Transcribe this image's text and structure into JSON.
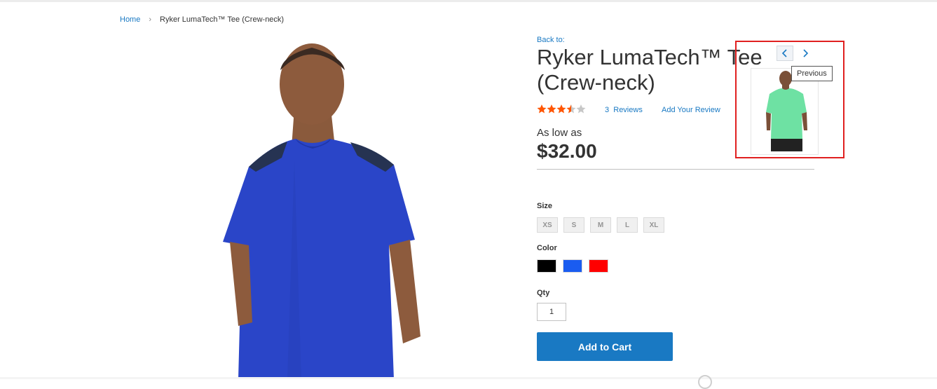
{
  "breadcrumbs": {
    "home": "Home",
    "separator": "›",
    "current": "Ryker LumaTech™ Tee (Crew-neck)"
  },
  "product": {
    "back_to": "Back to:",
    "title": "Ryker LumaTech™ Tee (Crew-neck)",
    "rating": {
      "value": 3.5,
      "max": 5
    },
    "reviews_count": "3",
    "reviews_label": "Reviews",
    "add_review": "Add Your Review",
    "price_prefix": "As low as",
    "price": "$32.00"
  },
  "options": {
    "size_label": "Size",
    "sizes": [
      "XS",
      "S",
      "M",
      "L",
      "XL"
    ],
    "color_label": "Color",
    "colors": [
      "#000000",
      "#1a5cf0",
      "#ff0000"
    ],
    "qty_label": "Qty",
    "qty_value": "1"
  },
  "actions": {
    "add_to_cart": "Add to Cart"
  },
  "product_nav": {
    "tooltip": "Previous",
    "prev_icon": "chevron-left-icon",
    "next_icon": "chevron-right-icon"
  },
  "colors": {
    "accent": "#1979c3",
    "star": "#ff5501",
    "highlight_box": "#e02020"
  }
}
